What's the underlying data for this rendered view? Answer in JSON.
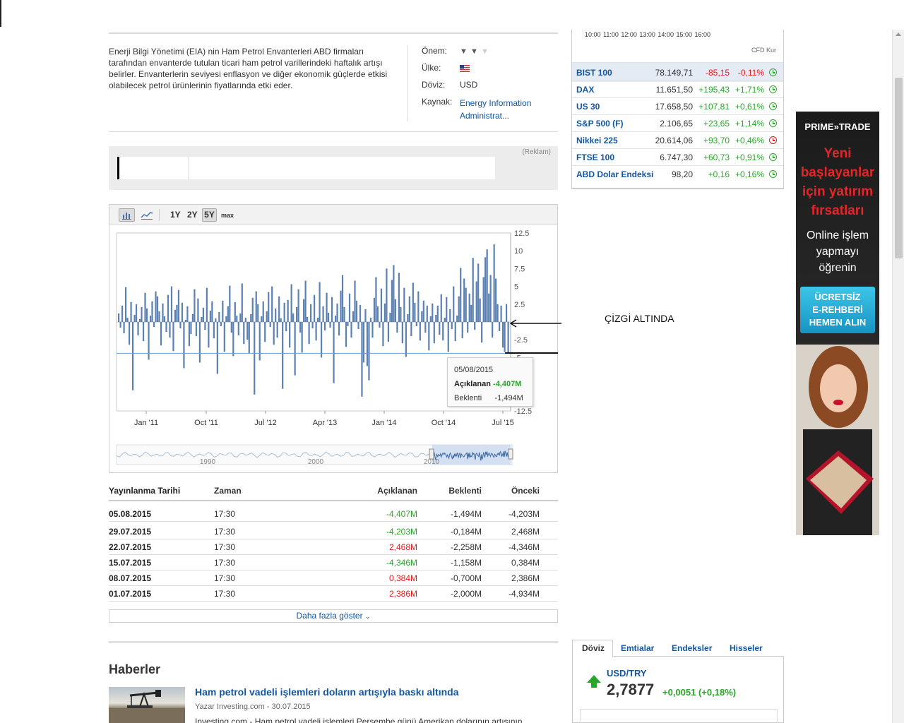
{
  "description": "Enerji Bilgi Yönetimi (EIA) nin Ham Petrol Envanterleri ABD firmaları tarafından envanterde tutulan ticari ham petrol varillerindeki haftalık artışı belirler. Envanterlerin seviyesi enflasyon ve diğer ekonomik güçlerde etkisi olabilecek petrol ürünlerinin fiyatlarında etki eder.",
  "meta": {
    "importance_label": "Önem:",
    "importance_level": 2,
    "importance_max": 3,
    "country_label": "Ülke:",
    "country_flag": "us-flag-icon",
    "currency_label": "Döviz:",
    "currency": "USD",
    "source_label": "Kaynak:",
    "source_line1": "Energy Information",
    "source_line2": "Administrat..."
  },
  "ad": {
    "label": "(Reklam)"
  },
  "chart_toolbar": {
    "bar_icon": "bar-chart-icon",
    "line_icon": "line-chart-icon",
    "range_1y": "1Y",
    "range_2y": "2Y",
    "range_5y": "5Y",
    "range_max": "max",
    "selected_range": "5Y"
  },
  "chart_data": {
    "type": "bar",
    "title": "",
    "ylabel": "",
    "ylim": [
      -12.5,
      12.5
    ],
    "y_ticks": [
      "12.5",
      "10",
      "7.5",
      "5",
      "2.5",
      "-2.5",
      "-5",
      "-12.5"
    ],
    "x_tick_labels": [
      "Jan '11",
      "Oct '11",
      "Jul '12",
      "Apr '13",
      "Jan '14",
      "Oct '14",
      "Jul '15"
    ],
    "x_range": [
      "2010-08",
      "2015-08"
    ],
    "reference_line_value": -4.407,
    "values": [
      1.2,
      -0.8,
      2.3,
      -1.6,
      4.9,
      0.6,
      -3.2,
      2.8,
      -9.6,
      1.0,
      2.5,
      -1.9,
      0.4,
      2.1,
      -2.7,
      4.1,
      1.9,
      -5.3,
      0.9,
      2.9,
      -0.7,
      4.3,
      3.6,
      1.5,
      -3.3,
      2.6,
      0.8,
      -1.4,
      3.8,
      -2.2,
      5.0,
      -4.1,
      1.7,
      2.4,
      4.5,
      -0.9,
      2.7,
      -6.5,
      0.3,
      2.2,
      -3.4,
      -1.7,
      1.1,
      4.6,
      -2.0,
      3.3,
      -5.7,
      0.7,
      2.0,
      -1.1,
      4.8,
      -3.6,
      1.6,
      2.9,
      -2.3,
      0.5,
      -7.3,
      1.4,
      -0.6,
      3.0,
      -4.2,
      0.8,
      2.2,
      5.1,
      -1.5,
      -4.8,
      2.8,
      0.9,
      -1.9,
      1.2,
      5.4,
      -3.1,
      0.6,
      -2.5,
      -4.4,
      1.1,
      3.4,
      -10.2,
      4.3,
      2.5,
      -5.4,
      0.8,
      2.9,
      -2.8,
      1.5,
      4.2,
      -0.7,
      5.0,
      -3.2,
      1.9,
      -2.2,
      3.6,
      0.5,
      -9.4,
      2.7,
      -1.3,
      3.1,
      -3.6,
      5.3,
      1.2,
      -7.5,
      2.1,
      4.6,
      -1.5,
      -4.3,
      3.2,
      5.8,
      0.7,
      -3.1,
      2.5,
      -0.9,
      3.8,
      -2.6,
      0.6,
      5.6,
      -5.0,
      2.2,
      -1.2,
      4.1,
      1.3,
      -0.8,
      3.5,
      -8.6,
      0.9,
      2.6,
      -1.9,
      4.4,
      6.6,
      2.1,
      -3.5,
      -0.6,
      4.0,
      -2.2,
      1.5,
      5.8,
      3.0,
      -1.0,
      2.4,
      -10.5,
      -5.7,
      1.8,
      -6.2,
      -8.2,
      0.6,
      -2.2,
      3.4,
      6.3,
      2.2,
      -0.8,
      4.7,
      -3.4,
      2.6,
      7.5,
      -2.8,
      1.3,
      5.9,
      8.0,
      3.2,
      -1.5,
      6.9,
      2.1,
      -3.0,
      4.8,
      -4.9,
      1.1,
      3.6,
      -2.0,
      5.5,
      2.7,
      -0.6,
      4.3,
      -2.6,
      1.5,
      3.0,
      -1.5,
      2.3,
      -4.0,
      0.8,
      2.6,
      -3.0,
      1.0,
      2.3,
      -1.8,
      3.9,
      -2.6,
      0.6,
      3.5,
      -4.2,
      1.8,
      -1.0,
      5.0,
      -2.7,
      0.9,
      3.6,
      7.6,
      -2.3,
      6.1,
      4.8,
      -1.5,
      4.0,
      2.4,
      9.0,
      -1.1,
      5.7,
      8.2,
      3.3,
      -2.9,
      6.3,
      9.1,
      10.2,
      4.0,
      6.6,
      -2.2,
      10.9,
      6.1,
      2.5,
      -1.3,
      2.3,
      -3.6,
      -4.2,
      2.5,
      -4.4
    ]
  },
  "tooltip": {
    "date": "05/08/2015",
    "actual_label": "Açıklanan",
    "actual_value": "-4,407M",
    "forecast_label": "Beklenti",
    "forecast_value": "-1,494M"
  },
  "navigator": {
    "labels": [
      "1990",
      "2000",
      "2010"
    ]
  },
  "annotation": {
    "text": "ÇİZGİ ALTINDA"
  },
  "table": {
    "headers": {
      "date": "Yayınlanma Tarihi",
      "time": "Zaman",
      "actual": "Açıklanan",
      "forecast": "Beklenti",
      "previous": "Önceki"
    },
    "rows": [
      {
        "date": "05.08.2015",
        "time": "17:30",
        "actual": "-4,407M",
        "actual_color": "green",
        "forecast": "-1,494M",
        "previous": "-4,203M"
      },
      {
        "date": "29.07.2015",
        "time": "17:30",
        "actual": "-4,203M",
        "actual_color": "green",
        "forecast": "-0,184M",
        "previous": "2,468M"
      },
      {
        "date": "22.07.2015",
        "time": "17:30",
        "actual": "2,468M",
        "actual_color": "red",
        "forecast": "-2,258M",
        "previous": "-4,346M"
      },
      {
        "date": "15.07.2015",
        "time": "17:30",
        "actual": "-4,346M",
        "actual_color": "green",
        "forecast": "-1,158M",
        "previous": "0,384M"
      },
      {
        "date": "08.07.2015",
        "time": "17:30",
        "actual": "0,384M",
        "actual_color": "red",
        "forecast": "-0,700M",
        "previous": "2,386M"
      },
      {
        "date": "01.07.2015",
        "time": "17:30",
        "actual": "2,386M",
        "actual_color": "red",
        "forecast": "-2,000M",
        "previous": "-4,934M"
      }
    ],
    "show_more": "Daha fazla göster"
  },
  "news": {
    "heading": "Haberler",
    "title": "Ham petrol vadeli işlemleri doların artışıyla baskı altında",
    "byline": "Yazar Investing.com - 30.07.2015",
    "snippet": "Investing.com - Ham petrol vadeli işlemleri Perşembe günü Amerikan dolarının artışının"
  },
  "indices_panel": {
    "time_axis": "10:00 11:00 12:00 13:00 14:00 15:00 16:00",
    "cfd_label": "CFD Kur",
    "rows": [
      {
        "name": "BIST 100",
        "value": "78.149,71",
        "change": "-85,15",
        "pct": "-0,11%",
        "dir": "red",
        "clock": "green"
      },
      {
        "name": "DAX",
        "value": "11.651,50",
        "change": "+195,43",
        "pct": "+1,71%",
        "dir": "green",
        "clock": "green"
      },
      {
        "name": "US 30",
        "value": "17.658,50",
        "change": "+107,81",
        "pct": "+0,61%",
        "dir": "green",
        "clock": "green"
      },
      {
        "name": "S&P 500 (F)",
        "value": "2.106,65",
        "change": "+23,65",
        "pct": "+1,14%",
        "dir": "green",
        "clock": "green"
      },
      {
        "name": "Nikkei 225",
        "value": "20.614,06",
        "change": "+93,70",
        "pct": "+0,46%",
        "dir": "green",
        "clock": "red"
      },
      {
        "name": "FTSE 100",
        "value": "6.747,30",
        "change": "+60,73",
        "pct": "+0,91%",
        "dir": "green",
        "clock": "green"
      },
      {
        "name": "ABD Dolar Endeksi",
        "value": "98,20",
        "change": "+0,16",
        "pct": "+0,16%",
        "dir": "green",
        "clock": "green"
      }
    ]
  },
  "banner": {
    "logo": "PRIME»TRADE",
    "headline": [
      "Yeni",
      "başlayanlar",
      "için yatırım",
      "fırsatları"
    ],
    "sub": [
      "Online işlem",
      "yapmayı",
      "öğrenin"
    ],
    "button": [
      "ÜCRETSİZ",
      "E-REHBERİ",
      "HEMEN ALIN"
    ]
  },
  "fx_tabs": {
    "tabs": [
      "Döviz",
      "Emtialar",
      "Endeksler",
      "Hisseler"
    ],
    "active": "Döviz"
  },
  "fx": {
    "pair": "USD/TRY",
    "value": "2,7877",
    "change": "+0,0051 (+0,18%)"
  },
  "colors": {
    "link": "#1256a0",
    "positive": "#2aa62a",
    "negative": "#e31b1b",
    "bar": "#5b80b2",
    "highlight_row": "#e4ebf4"
  }
}
